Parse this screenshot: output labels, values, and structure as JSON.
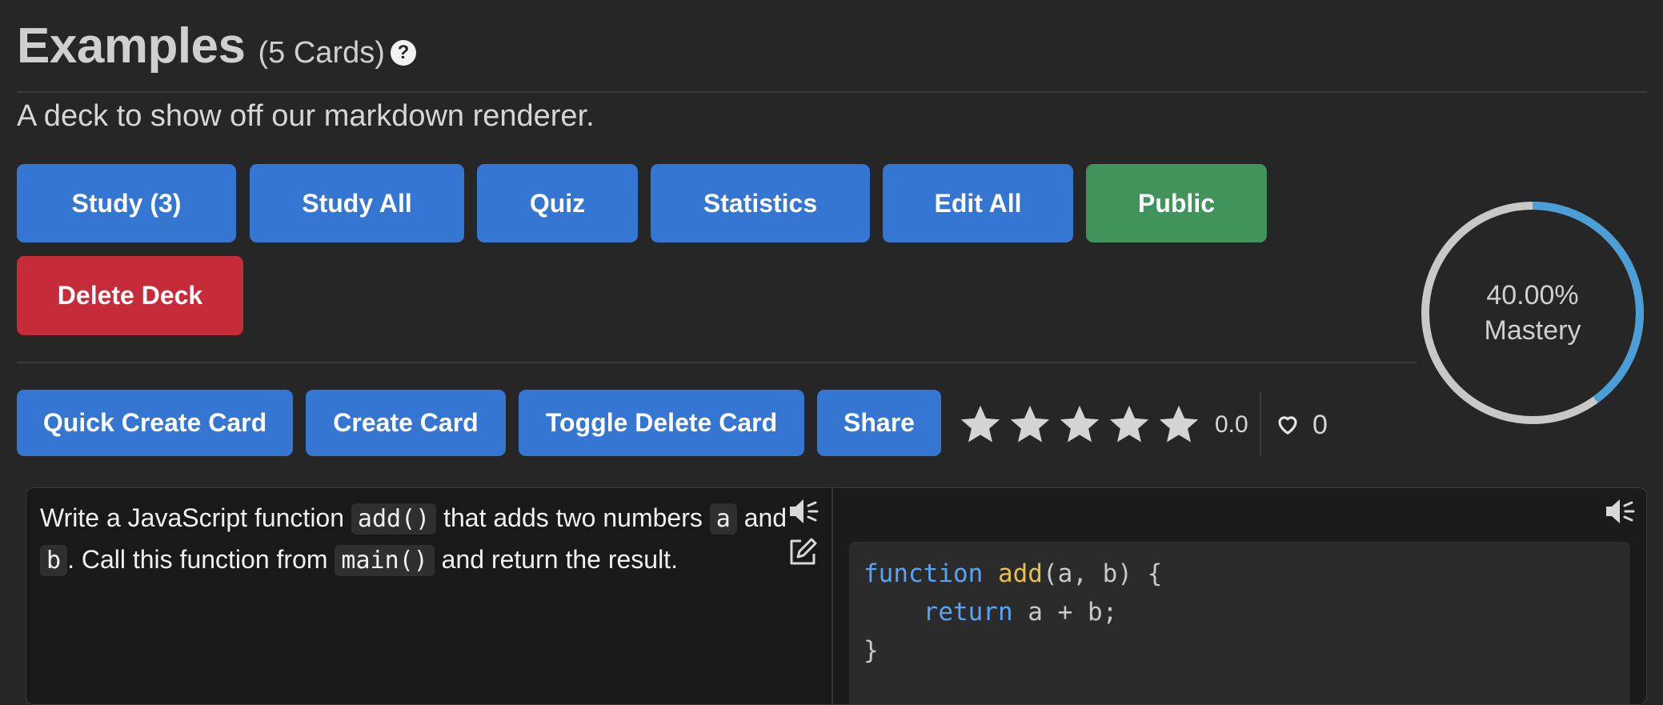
{
  "deck": {
    "title": "Examples",
    "card_count": "(5 Cards)",
    "help": "?",
    "description": "A deck to show off our markdown renderer."
  },
  "actions": {
    "study": "Study (3)",
    "study_all": "Study All",
    "quiz": "Quiz",
    "statistics": "Statistics",
    "edit_all": "Edit All",
    "public": "Public",
    "delete_deck": "Delete Deck"
  },
  "card_actions": {
    "quick_create": "Quick Create Card",
    "create": "Create Card",
    "toggle_delete": "Toggle Delete Card",
    "share": "Share"
  },
  "rating": {
    "value": "0.0",
    "stars_filled": 0,
    "stars_total": 5
  },
  "likes": {
    "count": "0"
  },
  "mastery": {
    "percent_text": "40.00%",
    "label": "Mastery",
    "fraction": 0.4
  },
  "colors": {
    "primary": "#3476d1",
    "success": "#40935a",
    "danger": "#c52b38",
    "ring_fill": "#4a9fd8",
    "ring_track": "#c8c8c8"
  },
  "card": {
    "front": {
      "t1": "Write a JavaScript function ",
      "c1": "add()",
      "t2": " that adds two numbers ",
      "c2": "a",
      "t3": " and ",
      "c3": "b",
      "t4": ". Call this function from ",
      "c4": "main()",
      "t5": " and return the result."
    },
    "back": {
      "code_l1_kw": "function",
      "code_l1_fn": "add",
      "code_l1_rest": "(a, b) {",
      "code_l2_kw": "return",
      "code_l2_rest": " a + b;",
      "code_l3": "}"
    },
    "icons": [
      "speaker-icon",
      "edit-icon"
    ]
  }
}
